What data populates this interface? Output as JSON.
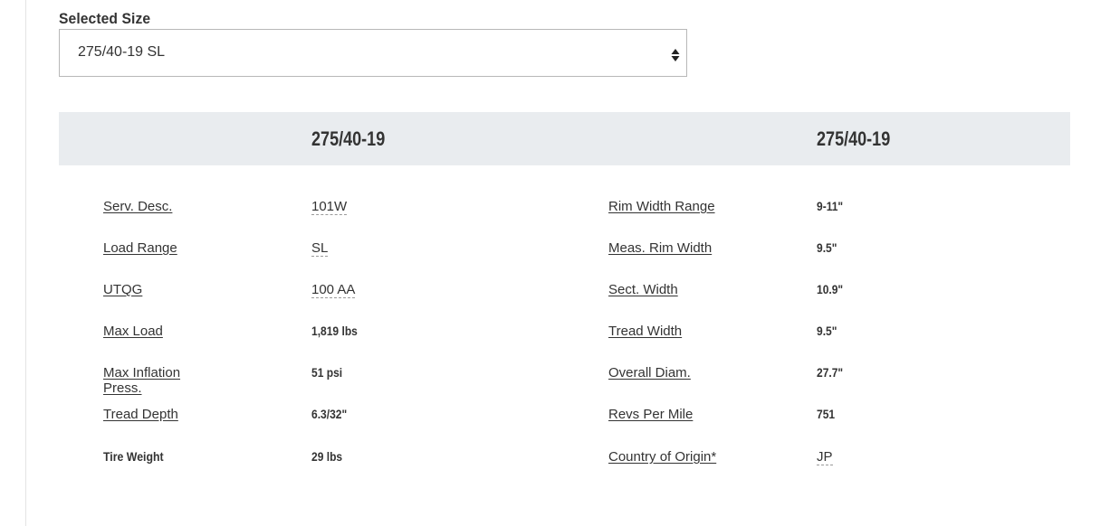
{
  "selector": {
    "label": "Selected Size",
    "value": "275/40-19 SL",
    "icon": "sort-arrows-icon"
  },
  "table": {
    "column_headers": [
      "275/40-19",
      "275/40-19"
    ],
    "left_specs": [
      {
        "label": "Serv. Desc.",
        "value": "101W"
      },
      {
        "label": "Load Range",
        "value": "SL"
      },
      {
        "label": "UTQG",
        "value": "100 AA"
      },
      {
        "label": "Max Load",
        "value": "1,819 lbs"
      },
      {
        "label": "Max Inflation Press.",
        "value": "51 psi"
      },
      {
        "label": "Tread Depth",
        "value": "6.3/32\""
      },
      {
        "label": "Tire Weight",
        "value": "29 lbs"
      }
    ],
    "right_specs": [
      {
        "label": "Rim Width Range",
        "value": "9-11\""
      },
      {
        "label": "Meas. Rim Width",
        "value": "9.5\""
      },
      {
        "label": "Sect. Width",
        "value": "10.9\""
      },
      {
        "label": "Tread Width",
        "value": "9.5\""
      },
      {
        "label": "Overall Diam.",
        "value": "27.7\""
      },
      {
        "label": "Revs Per Mile",
        "value": "751"
      },
      {
        "label": "Country of Origin*",
        "value": "JP"
      }
    ]
  },
  "colors": {
    "header_band": "#e9ecef",
    "text": "#333333",
    "select_border": "#b8b8b8"
  }
}
